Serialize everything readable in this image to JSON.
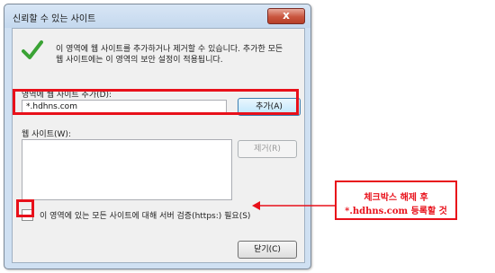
{
  "dialog": {
    "title": "신뢰할 수 있는 사이트",
    "close_glyph": "x"
  },
  "info": {
    "line1": "이 영역에 웹 사이트를 추가하거나 제거할 수 있습니다. 추가한 모든",
    "line2": "웹 사이트에는 이 영역의 보안 설정이 적용됩니다."
  },
  "add_site": {
    "label": "영역에 웹 사이트 추가(D):",
    "value": "*.hdhns.com",
    "button_label": "추가(A)"
  },
  "websites": {
    "label": "웹 사이트(W):",
    "items": [],
    "remove_label": "제거(R)"
  },
  "https_option": {
    "label": "이 영역에 있는 모든 사이트에 대해 서버 검증(https:) 필요(S)",
    "checked": false
  },
  "close_button_label": "닫기(C)",
  "annotation": {
    "line1": "체크박스 해제 후",
    "line2": "*.hdhns.com 등록할 것"
  },
  "colors": {
    "highlight": "#e8101a",
    "check_green": "#3aa335"
  },
  "icons": {
    "check": "green-checkmark"
  }
}
